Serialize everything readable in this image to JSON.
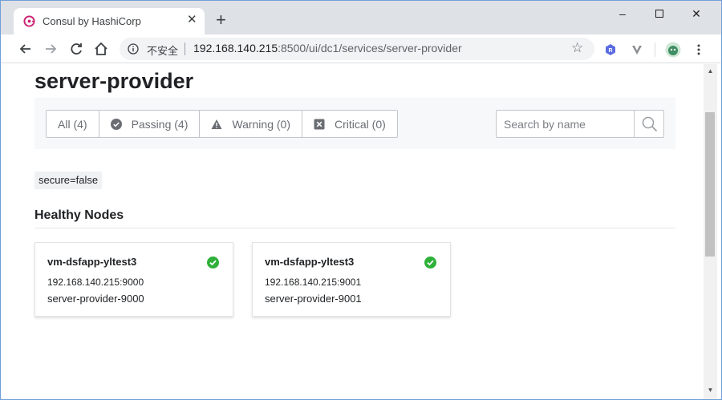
{
  "browser": {
    "tab_title": "Consul by HashiCorp",
    "tab_close": "✕",
    "new_tab": "+",
    "window_min": "–",
    "window_close": "✕",
    "security_label": "不安全",
    "url_host": "192.168.140.215",
    "url_rest": ":8500/ui/dc1/services/server-provider",
    "accent_color": "#ca2171"
  },
  "page": {
    "title": "server-provider",
    "filters": [
      {
        "label": "All (4)",
        "icon": "none"
      },
      {
        "label": "Passing (4)",
        "icon": "check-circle-icon"
      },
      {
        "label": "Warning (0)",
        "icon": "warning-icon"
      },
      {
        "label": "Critical (0)",
        "icon": "critical-icon"
      }
    ],
    "search_placeholder": "Search by name",
    "tag": "secure=false",
    "section_title": "Healthy Nodes",
    "nodes": [
      {
        "name": "vm-dsfapp-yltest3",
        "address": "192.168.140.215:9000",
        "service_id": "server-provider-9000",
        "status_color": "#2eb039"
      },
      {
        "name": "vm-dsfapp-yltest3",
        "address": "192.168.140.215:9001",
        "service_id": "server-provider-9001",
        "status_color": "#2eb039"
      }
    ]
  }
}
